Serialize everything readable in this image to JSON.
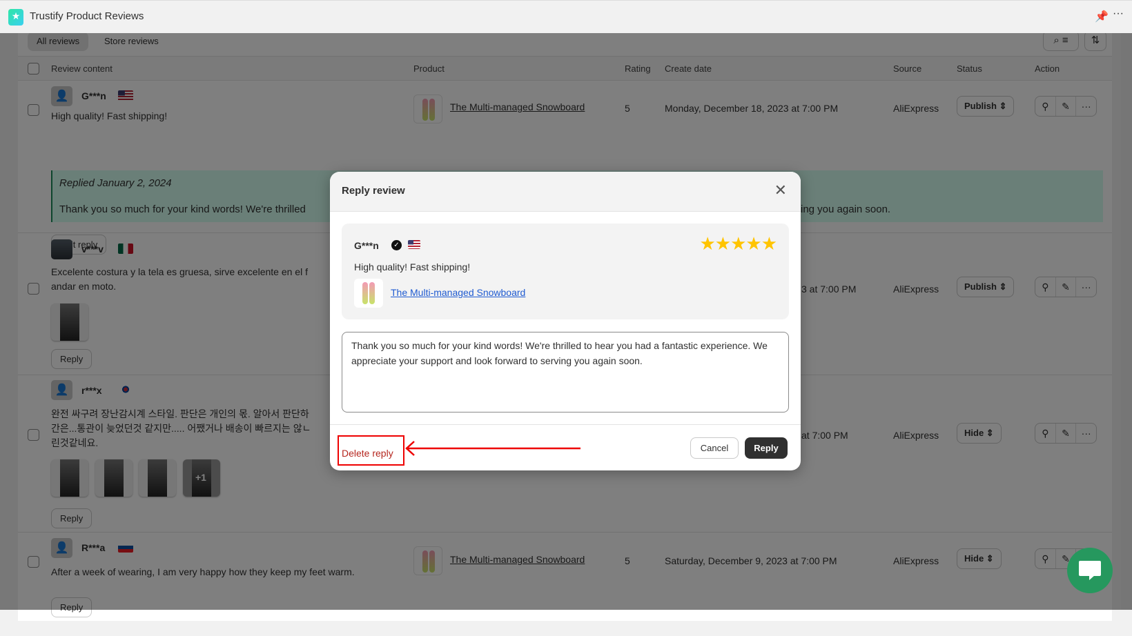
{
  "app": {
    "title": "Trustify Product Reviews",
    "logo_text": "trustify"
  },
  "tabs": [
    {
      "label": "All reviews",
      "active": true
    },
    {
      "label": "Store reviews",
      "active": false
    }
  ],
  "columns": [
    "Review content",
    "Product",
    "Rating",
    "Create date",
    "Source",
    "Status",
    "Action"
  ],
  "rows": [
    {
      "user": "G***n",
      "flag": "us",
      "lines": [
        "High quality! Fast shipping!"
      ],
      "product": "The Multi-managed Snowboard",
      "rating": "5",
      "date": "Monday, December 18, 2023 at 7:00 PM",
      "source": "AliExpress",
      "status": "Publish",
      "reply": {
        "title": "Replied January 2, 2024",
        "text_left": "Thank you so much for your kind words! We're thrilled",
        "text_right": "ing you again soon."
      },
      "button": "Edit reply"
    },
    {
      "user": "v***v",
      "flag": "mx",
      "lines": [
        "Excelente costura y la tela es gruesa, sirve excelente en el f",
        "andar en moto."
      ],
      "date_partial": "3 at 7:00 PM",
      "source": "AliExpress",
      "status": "Publish",
      "button": "Reply"
    },
    {
      "user": "r***x",
      "flag": "kr",
      "lines": [
        "완전 싸구려 장난감시계 스타일. 판단은 개인의 몫. 알아서 판단하",
        "간은...통관이 늦었던것 같지만..... 어쨌거나 배송이 빠르지는 않ㄴ",
        "린것같네요."
      ],
      "more_images": "+1",
      "date_partial": "at 7:00 PM",
      "source": "AliExpress",
      "status": "Hide",
      "button": "Reply"
    },
    {
      "user": "R***a",
      "flag": "sk",
      "lines": [
        "After a week of wearing, I am very happy how they keep my feet warm."
      ],
      "product": "The Multi-managed Snowboard",
      "rating": "5",
      "date": "Saturday, December 9, 2023 at 7:00 PM",
      "source": "AliExpress",
      "status": "Hide",
      "button": "Reply"
    }
  ],
  "modal": {
    "title": "Reply review",
    "user": "G***n",
    "rating": 5,
    "review": "High quality! Fast shipping!",
    "product": "The Multi-managed Snowboard",
    "reply_text": "Thank you so much for your kind words! We're thrilled to hear you had a fantastic experience. We appreciate your support and look forward to serving you again soon.",
    "delete_label": "Delete reply",
    "cancel_label": "Cancel",
    "reply_label": "Reply"
  },
  "colors": {
    "accent": "#303030",
    "reply_bg": "#d4fef0",
    "danger": "#b5261e",
    "star": "#ffc400",
    "chat": "#26985e",
    "highlight": "#ee0000"
  }
}
